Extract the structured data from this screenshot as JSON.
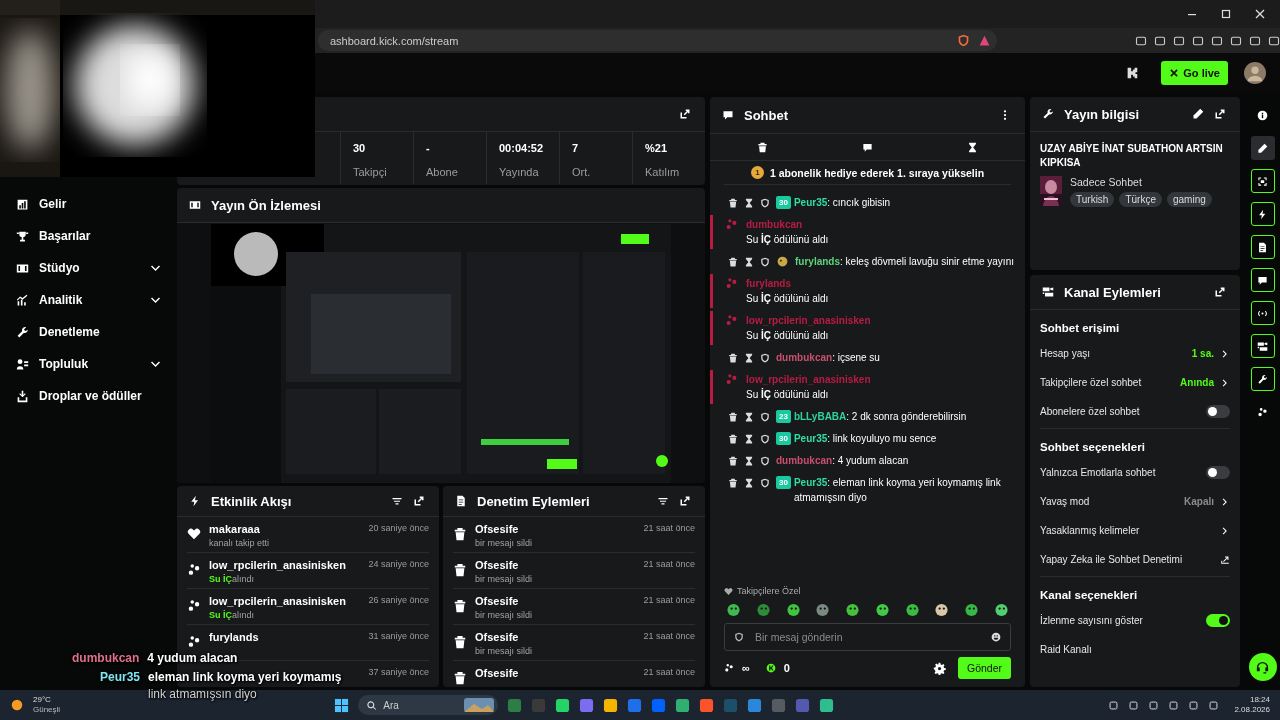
{
  "browser": {
    "url": "ashboard.kick.com/stream"
  },
  "header": {
    "go_live": "Go live"
  },
  "sidebar": {
    "items": [
      {
        "label": "Gelir",
        "kind": "link"
      },
      {
        "label": "Başarılar",
        "kind": "link"
      },
      {
        "label": "Stüdyo",
        "kind": "group"
      },
      {
        "label": "Analitik",
        "kind": "group"
      },
      {
        "label": "Denetleme",
        "kind": "link"
      },
      {
        "label": "Topluluk",
        "kind": "group"
      },
      {
        "label": "Droplar ve ödüller",
        "kind": "link"
      }
    ]
  },
  "stats": {
    "cells": [
      {
        "value": "30",
        "label": "Takipçi"
      },
      {
        "value": "-",
        "label": "Abone"
      },
      {
        "value": "00:04:52",
        "label": "Yayında"
      },
      {
        "value": "7",
        "label": "Ort."
      },
      {
        "value": "%21",
        "label": "Katılım"
      }
    ]
  },
  "preview": {
    "title": "Yayın Ön İzlemesi"
  },
  "activity": {
    "title": "Etkinlik Akışı",
    "items": [
      {
        "kind": "follow",
        "user": "makaraaa",
        "detail": "kanalı takip etti",
        "time": "20 saniye önce"
      },
      {
        "kind": "reward",
        "user": "low_rpcilerin_anasinisken",
        "reward": "Su İÇ",
        "detail": "alındı",
        "time": "24 saniye önce"
      },
      {
        "kind": "reward",
        "user": "low_rpcilerin_anasinisken",
        "reward": "Su İÇ",
        "detail": "alındı",
        "time": "26 saniye önce"
      },
      {
        "kind": "reward",
        "user": "furylands",
        "time": "31 saniye önce"
      },
      {
        "kind": "reward",
        "time": "37 saniye önce"
      }
    ]
  },
  "moderation": {
    "title": "Denetim Eylemleri",
    "items": [
      {
        "user": "Ofsesife",
        "detail": "bir mesajı sildi",
        "time": "21 saat önce"
      },
      {
        "user": "Ofsesife",
        "detail": "bir mesajı sildi",
        "time": "21 saat önce"
      },
      {
        "user": "Ofsesife",
        "detail": "bir mesajı sildi",
        "time": "21 saat önce"
      },
      {
        "user": "Ofsesife",
        "detail": "bir mesajı sildi",
        "time": "21 saat önce"
      },
      {
        "user": "Ofsesife",
        "time": "21 saat önce"
      }
    ]
  },
  "chat": {
    "title": "Sohbet",
    "pinned": {
      "rank": "1",
      "text": "1 abonelik hediye ederek 1. sıraya yükselin"
    },
    "messages": [
      {
        "kind": "message",
        "badge": {
          "kind": "sub",
          "text": "30"
        },
        "user": "Peur35",
        "color": "#2fe0a0",
        "text": ": cıncık gibisin"
      },
      {
        "kind": "reward",
        "user": "dumbukcan",
        "color": "#b81c44",
        "text": "Su **İÇ** ödülünü aldı"
      },
      {
        "kind": "message",
        "badge": {
          "kind": "emote"
        },
        "user": "furylands",
        "color": "#5ed47c",
        "text": ": keleş dövmeli lavuğu sinir etme yayını"
      },
      {
        "kind": "reward",
        "user": "furylands",
        "color": "#b81c44",
        "text": "Su **İÇ** ödülünü aldı"
      },
      {
        "kind": "reward",
        "user": "low_rpcilerin_anasinisken",
        "color": "#b81c44",
        "text": "Su **İÇ** ödülünü aldı"
      },
      {
        "kind": "message",
        "user": "dumbukcan",
        "color": "#c9506f",
        "text": ": içsene su"
      },
      {
        "kind": "reward",
        "user": "low_rpcilerin_anasinisken",
        "color": "#b81c44",
        "text": "Su **İÇ** ödülünü aldı"
      },
      {
        "kind": "message",
        "badge": {
          "kind": "sub",
          "text": "23"
        },
        "user": "bLLyBABA",
        "color": "#2fd3a0",
        "text": ": 2 dk sonra gönderebilirsin"
      },
      {
        "kind": "message",
        "badge": {
          "kind": "sub",
          "text": "30"
        },
        "user": "Peur35",
        "color": "#2fe0a0",
        "text": ": link koyuluyo mu sence"
      },
      {
        "kind": "message",
        "user": "dumbukcan",
        "color": "#c9506f",
        "text": ": 4 yudum alacan"
      },
      {
        "kind": "message",
        "badge": {
          "kind": "sub",
          "text": "30"
        },
        "user": "Peur35",
        "color": "#2fe0a0",
        "text": ": eleman link koyma yeri koymamış link atmamışsın diyo"
      }
    ],
    "emote_label": "Takipçilere Özel",
    "input": {
      "placeholder": "Bir mesaj gönderin"
    },
    "points": "∞",
    "kicks": "0",
    "send": "Gönder"
  },
  "stream_info": {
    "title": "Yayın bilgisi",
    "stream_title": "UZAY ABİYE İNAT SUBATHON ARTSIN KIPKISA",
    "category": "Sadece Sohbet",
    "tags": [
      "Turkish",
      "Türkçe",
      "gaming"
    ]
  },
  "channel_actions": {
    "title": "Kanal Eylemleri",
    "sections": [
      {
        "title": "Sohbet erişimi",
        "rows": [
          {
            "kind": "value",
            "label": "Hesap yaşı",
            "value": "1 sa.",
            "active": true
          },
          {
            "kind": "value",
            "label": "Takipçilere özel sohbet",
            "value": "Anında",
            "active": true
          },
          {
            "kind": "toggle",
            "label": "Abonelere özel sohbet",
            "on": false
          }
        ]
      },
      {
        "title": "Sohbet seçenekleri",
        "rows": [
          {
            "kind": "toggle",
            "label": "Yalnızca Emotlarla sohbet",
            "on": false
          },
          {
            "kind": "value",
            "label": "Yavaş mod",
            "value": "Kapalı",
            "active": false
          },
          {
            "kind": "link",
            "label": "Yasaklanmış kelimeler"
          },
          {
            "kind": "external",
            "label": "Yapay Zeka ile Sohbet Denetimi"
          }
        ]
      },
      {
        "title": "Kanal seçenekleri",
        "rows": [
          {
            "kind": "toggle",
            "label": "İzlenme sayısını göster",
            "on": true
          },
          {
            "kind": "plain",
            "label": "Raid Kanalı"
          }
        ]
      }
    ]
  },
  "rail": [
    {
      "selected": false,
      "active": false
    },
    {
      "selected": true,
      "active": false
    },
    {
      "selected": false,
      "active": true
    },
    {
      "selected": false,
      "active": true
    },
    {
      "selected": false,
      "active": true
    },
    {
      "selected": false,
      "active": true
    },
    {
      "selected": false,
      "active": true
    },
    {
      "selected": false,
      "active": true
    },
    {
      "selected": false,
      "active": true
    },
    {
      "selected": false,
      "active": false
    }
  ],
  "overlay_chat": [
    {
      "user": "dumbukcan",
      "color": "#e0708a",
      "lines": [
        "4 yudum alacan"
      ]
    },
    {
      "user": "Peur35",
      "color": "#7fe6f0",
      "lines": [
        "eleman link koyma yeri koymamış",
        "link atmamışsın diyo"
      ]
    }
  ],
  "taskbar": {
    "temp": "29°C",
    "condition": "Güneşli",
    "search": "Ara",
    "time": "18:24",
    "date": "2.08.2026"
  }
}
